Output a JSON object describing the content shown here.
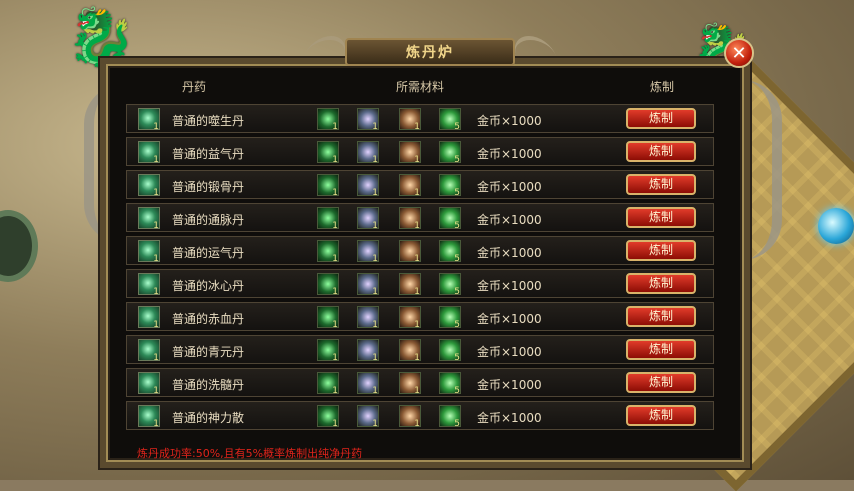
{
  "window": {
    "title": "炼丹炉",
    "close_label": "✕"
  },
  "headers": {
    "name": "丹药",
    "materials": "所需材料",
    "make": "炼制"
  },
  "rows": [
    {
      "name": "普通的噬生丹",
      "pill_qty": "1",
      "materials": [
        {
          "icon": "green-herb-icon",
          "qty": "1"
        },
        {
          "icon": "spirit-grass-icon",
          "qty": "1"
        },
        {
          "icon": "ore-icon",
          "qty": "1"
        },
        {
          "icon": "jade-icon",
          "qty": "5"
        }
      ],
      "cost": "金币×1000",
      "button": "炼制"
    },
    {
      "name": "普通的益气丹",
      "pill_qty": "1",
      "materials": [
        {
          "icon": "green-herb-icon",
          "qty": "1"
        },
        {
          "icon": "spirit-grass-icon",
          "qty": "1"
        },
        {
          "icon": "ore-icon",
          "qty": "1"
        },
        {
          "icon": "jade-icon",
          "qty": "5"
        }
      ],
      "cost": "金币×1000",
      "button": "炼制"
    },
    {
      "name": "普通的锻骨丹",
      "pill_qty": "1",
      "materials": [
        {
          "icon": "green-herb-icon",
          "qty": "1"
        },
        {
          "icon": "spirit-grass-icon",
          "qty": "1"
        },
        {
          "icon": "ore-icon",
          "qty": "1"
        },
        {
          "icon": "jade-icon",
          "qty": "5"
        }
      ],
      "cost": "金币×1000",
      "button": "炼制"
    },
    {
      "name": "普通的通脉丹",
      "pill_qty": "1",
      "materials": [
        {
          "icon": "green-herb-icon",
          "qty": "1"
        },
        {
          "icon": "spirit-grass-icon",
          "qty": "1"
        },
        {
          "icon": "ore-icon",
          "qty": "1"
        },
        {
          "icon": "jade-icon",
          "qty": "5"
        }
      ],
      "cost": "金币×1000",
      "button": "炼制"
    },
    {
      "name": "普通的运气丹",
      "pill_qty": "1",
      "materials": [
        {
          "icon": "green-herb-icon",
          "qty": "1"
        },
        {
          "icon": "spirit-grass-icon",
          "qty": "1"
        },
        {
          "icon": "ore-icon",
          "qty": "1"
        },
        {
          "icon": "jade-icon",
          "qty": "5"
        }
      ],
      "cost": "金币×1000",
      "button": "炼制"
    },
    {
      "name": "普通的冰心丹",
      "pill_qty": "1",
      "materials": [
        {
          "icon": "green-herb-icon",
          "qty": "1"
        },
        {
          "icon": "spirit-grass-icon",
          "qty": "1"
        },
        {
          "icon": "ore-icon",
          "qty": "1"
        },
        {
          "icon": "jade-icon",
          "qty": "5"
        }
      ],
      "cost": "金币×1000",
      "button": "炼制"
    },
    {
      "name": "普通的赤血丹",
      "pill_qty": "1",
      "materials": [
        {
          "icon": "green-herb-icon",
          "qty": "1"
        },
        {
          "icon": "spirit-grass-icon",
          "qty": "1"
        },
        {
          "icon": "ore-icon",
          "qty": "1"
        },
        {
          "icon": "jade-icon",
          "qty": "5"
        }
      ],
      "cost": "金币×1000",
      "button": "炼制"
    },
    {
      "name": "普通的青元丹",
      "pill_qty": "1",
      "materials": [
        {
          "icon": "green-herb-icon",
          "qty": "1"
        },
        {
          "icon": "spirit-grass-icon",
          "qty": "1"
        },
        {
          "icon": "ore-icon",
          "qty": "1"
        },
        {
          "icon": "jade-icon",
          "qty": "5"
        }
      ],
      "cost": "金币×1000",
      "button": "炼制"
    },
    {
      "name": "普通的洗髓丹",
      "pill_qty": "1",
      "materials": [
        {
          "icon": "green-herb-icon",
          "qty": "1"
        },
        {
          "icon": "spirit-grass-icon",
          "qty": "1"
        },
        {
          "icon": "ore-icon",
          "qty": "1"
        },
        {
          "icon": "jade-icon",
          "qty": "5"
        }
      ],
      "cost": "金币×1000",
      "button": "炼制"
    },
    {
      "name": "普通的神力散",
      "pill_qty": "1",
      "materials": [
        {
          "icon": "green-herb-icon",
          "qty": "1"
        },
        {
          "icon": "spirit-grass-icon",
          "qty": "1"
        },
        {
          "icon": "ore-icon",
          "qty": "1"
        },
        {
          "icon": "jade-icon",
          "qty": "5"
        }
      ],
      "cost": "金币×1000",
      "button": "炼制"
    }
  ],
  "footer": {
    "note": "炼丹成功率:50%,且有5%概率炼制出纯净丹药"
  },
  "colors": {
    "button_red": "#c4170b",
    "footer_red": "#e0241b",
    "gold_border": "#d9b36a"
  }
}
